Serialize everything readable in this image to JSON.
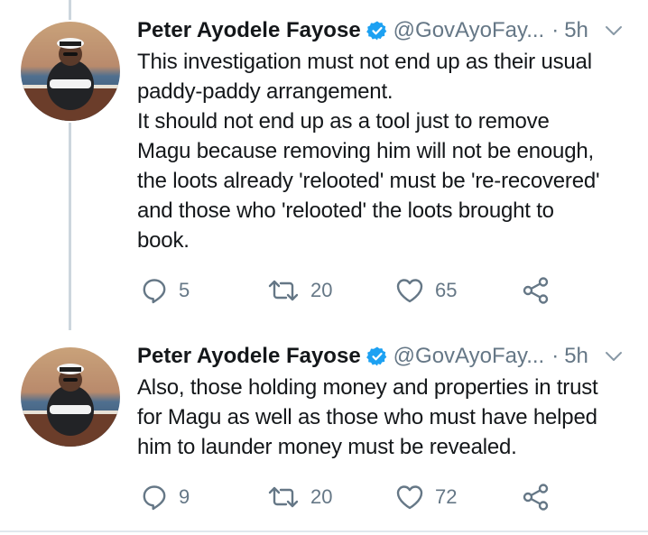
{
  "tweets": [
    {
      "author_name": "Peter Ayodele Fayose",
      "handle": "@GovAyoFay...",
      "separator": "·",
      "time": "5h",
      "text": "This investigation must not end up as their usual\npaddy-paddy arrangement.\nIt should not end up as a tool just to remove\nMagu because removing him will not be enough,\nthe loots already 'relooted' must be 're-recovered'\nand those who 'relooted' the loots brought to\nbook.",
      "replies": "5",
      "retweets": "20",
      "likes": "65"
    },
    {
      "author_name": "Peter Ayodele Fayose",
      "handle": "@GovAyoFay...",
      "separator": "·",
      "time": "5h",
      "text": "Also, those holding money and properties in trust\nfor Magu as well as those who must have helped\nhim to launder money must be revealed.",
      "replies": "9",
      "retweets": "20",
      "likes": "72"
    }
  ],
  "icons": {
    "verified": "verified-badge-icon",
    "caret": "chevron-down-icon",
    "reply": "reply-icon",
    "retweet": "retweet-icon",
    "like": "heart-icon",
    "share": "share-icon"
  },
  "colors": {
    "text": "#14171a",
    "secondary": "#657786",
    "verified_blue": "#1da1f2",
    "thread_line": "#ccd6dd"
  }
}
